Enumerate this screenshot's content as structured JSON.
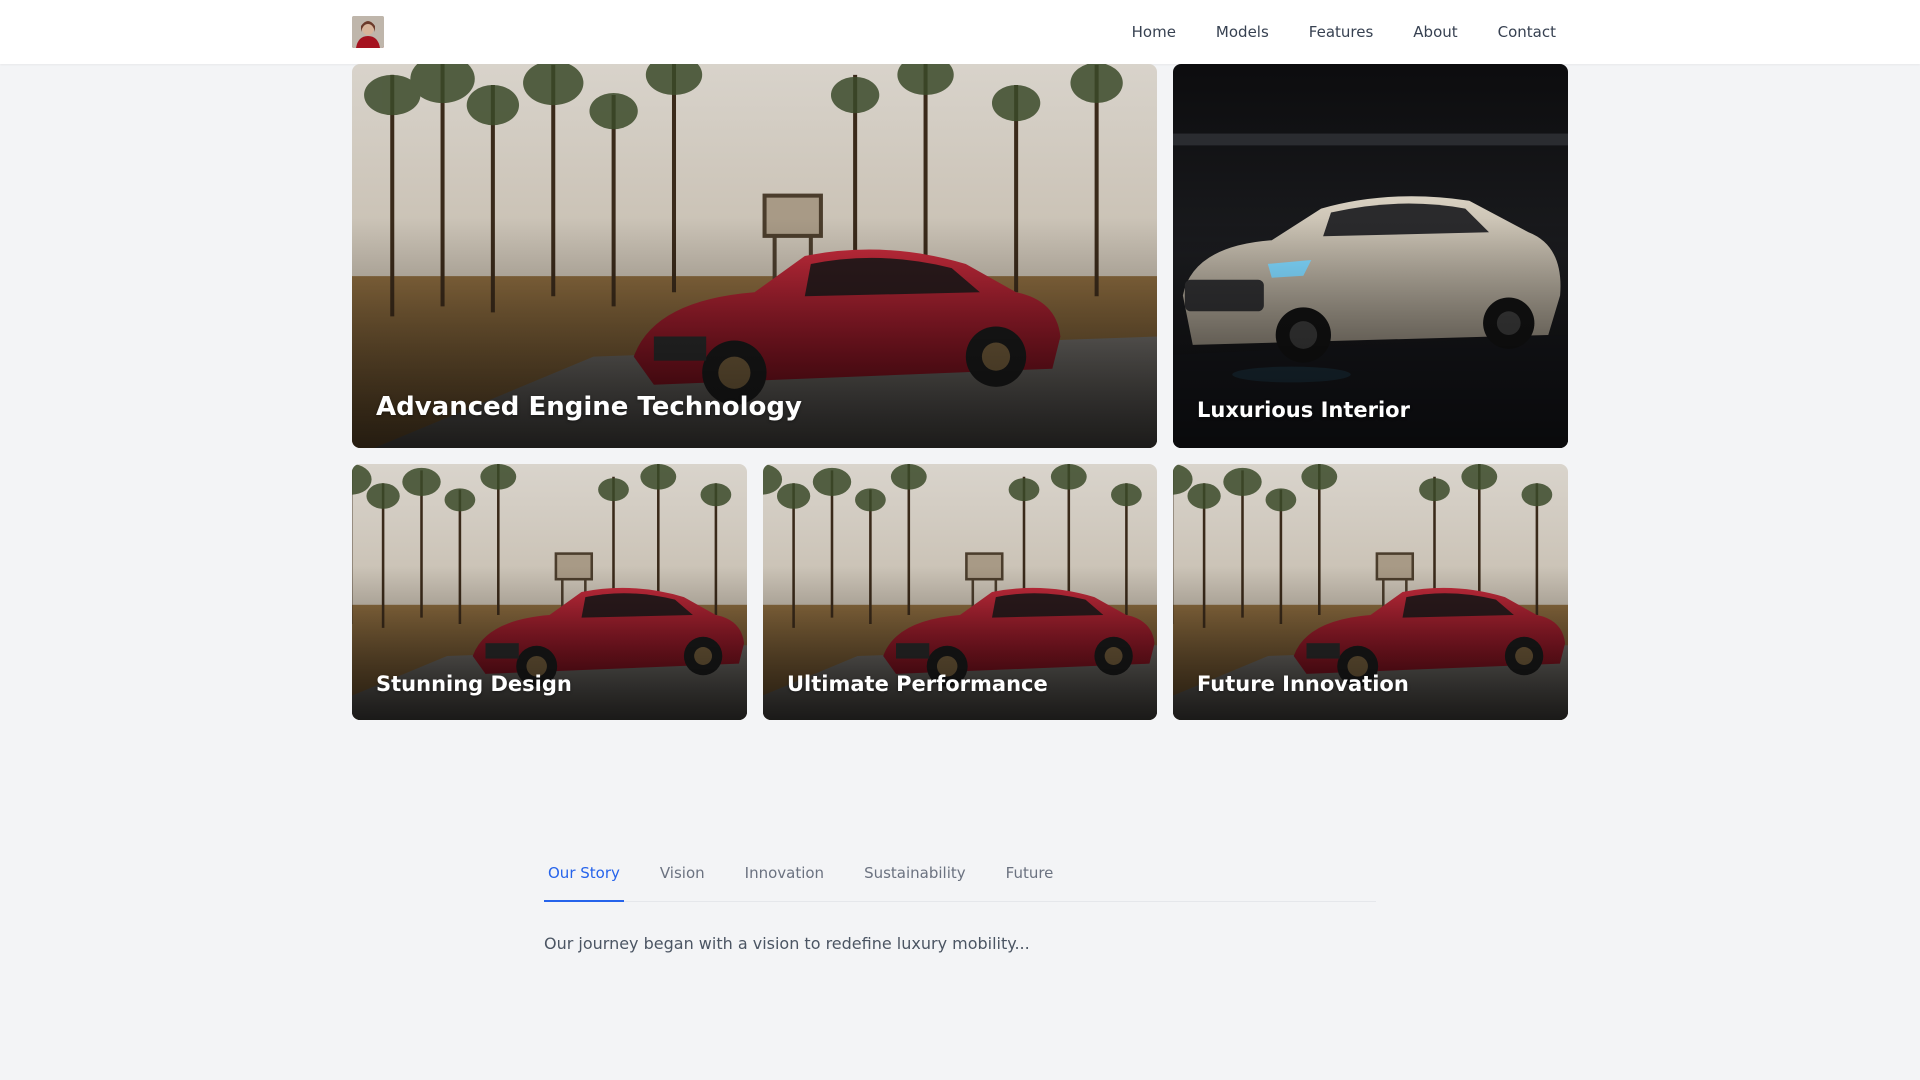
{
  "header": {
    "logo_alt": "Logo",
    "nav": [
      "Home",
      "Models",
      "Features",
      "About",
      "Contact"
    ]
  },
  "cards": {
    "main": "Advanced Engine Technology",
    "interior": "Luxurious Interior",
    "small": [
      "Stunning Design",
      "Ultimate Performance",
      "Future Innovation"
    ]
  },
  "tabs": {
    "items": [
      "Our Story",
      "Vision",
      "Innovation",
      "Sustainability",
      "Future"
    ],
    "active": "Our Story",
    "content": "Our journey began with a vision to redefine luxury mobility..."
  },
  "colors": {
    "accent": "#2563eb",
    "background": "#f3f4f6",
    "car_red": "#9e1b2a"
  }
}
